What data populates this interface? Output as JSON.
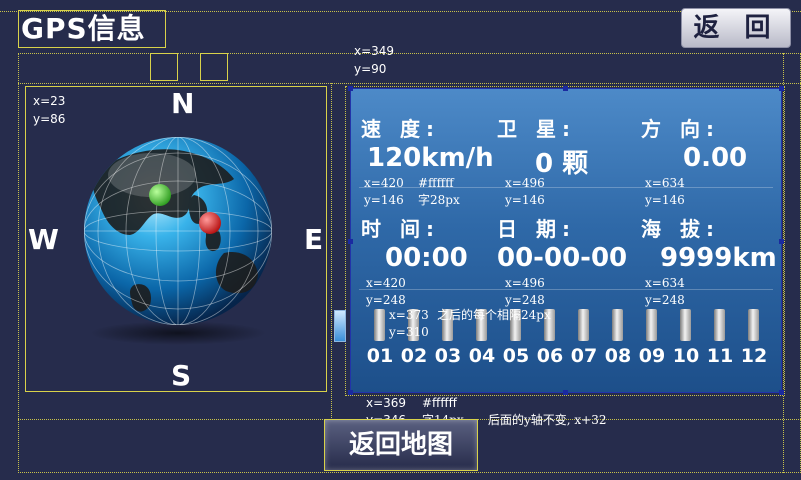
{
  "header": {
    "title": "GPS信息",
    "back_label": "返 回"
  },
  "compass": {
    "north": "N",
    "south": "S",
    "east": "E",
    "west": "W"
  },
  "info_panel": {
    "speed_label": "速 度:",
    "speed_value": "120km/h",
    "satellite_label": "卫 星:",
    "satellite_value": "0 颗",
    "direction_label": "方 向:",
    "direction_value": "0.00",
    "time_label": "时 间:",
    "time_value": "00:00",
    "date_label": "日 期:",
    "date_value": "00-00-00",
    "altitude_label": "海 拔:",
    "altitude_value": "9999km",
    "satellites": [
      {
        "id": "01",
        "level": 1
      },
      {
        "id": "02",
        "level": 1
      },
      {
        "id": "03",
        "level": 1
      },
      {
        "id": "04",
        "level": 1
      },
      {
        "id": "05",
        "level": 1
      },
      {
        "id": "06",
        "level": 1
      },
      {
        "id": "07",
        "level": 1
      },
      {
        "id": "08",
        "level": 1
      },
      {
        "id": "09",
        "level": 1
      },
      {
        "id": "10",
        "level": 1
      },
      {
        "id": "11",
        "level": 1
      },
      {
        "id": "12",
        "level": 1
      }
    ]
  },
  "annotations": {
    "panel_pos": [
      "x=349",
      "y=90"
    ],
    "compass_pos": [
      "x=23",
      "y=86"
    ],
    "speed_pos": [
      "x=420",
      "y=146",
      "#ffffff",
      "字28px"
    ],
    "sat_pos": [
      "x=496",
      "y=146"
    ],
    "dir_pos": [
      "x=634",
      "y=146"
    ],
    "time_pos": [
      "x=420",
      "y=248"
    ],
    "date_pos": [
      "x=496",
      "y=248"
    ],
    "alt_pos": [
      "x=634",
      "y=248"
    ],
    "bar_pos": [
      "x=373",
      "y=310",
      "之后的每个相隔24px"
    ],
    "num_pos": [
      "x=369",
      "y=346",
      "#ffffff",
      "字14px",
      "后面的y轴不变, x+32"
    ]
  },
  "map_button_label": "返回地图",
  "colors": {
    "background": "#262c4c",
    "panel_top": "#4d8ac8",
    "panel_bottom": "#1d4f8a",
    "guide": "#d8d24a",
    "text": "#ffffff"
  }
}
